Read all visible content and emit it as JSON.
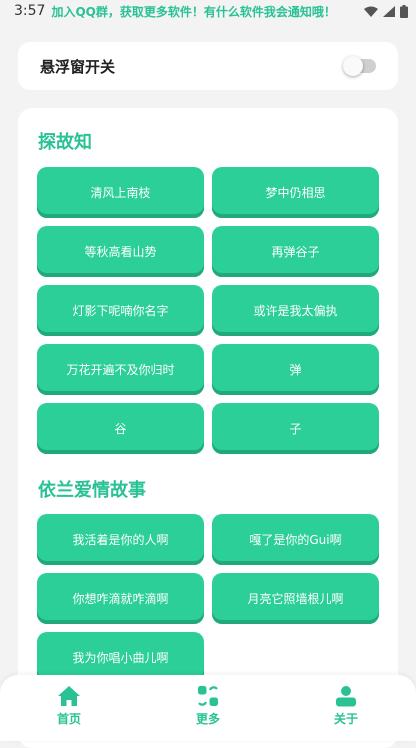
{
  "status_bar": {
    "time": "3:57",
    "message": "加入QQ群，获取更多软件！有什么软件我会通知哦！"
  },
  "floating_window": {
    "label": "悬浮窗开关",
    "enabled": false
  },
  "sections": [
    {
      "title": "探故知",
      "buttons": [
        "清风上南枝",
        "梦中仍相思",
        "等秋高看山势",
        "再弹谷子",
        "灯影下呢喃你名字",
        "或许是我太偏执",
        "万花开遍不及你归时",
        "弹",
        "谷",
        "子"
      ]
    },
    {
      "title": "依兰爱情故事",
      "buttons": [
        "我活着是你的人啊",
        "嘎了是你的Gui啊",
        "你想咋滴就咋滴啊",
        "月亮它照墙根儿啊",
        "我为你唱小曲儿啊"
      ]
    }
  ],
  "bottom_nav": {
    "items": [
      {
        "label": "首页",
        "icon": "home-icon"
      },
      {
        "label": "更多",
        "icon": "more-icon"
      },
      {
        "label": "关于",
        "icon": "user-icon"
      }
    ]
  },
  "colors": {
    "accent": "#2ac295",
    "button": "#2bcf97",
    "button_shadow": "#21a97b"
  }
}
